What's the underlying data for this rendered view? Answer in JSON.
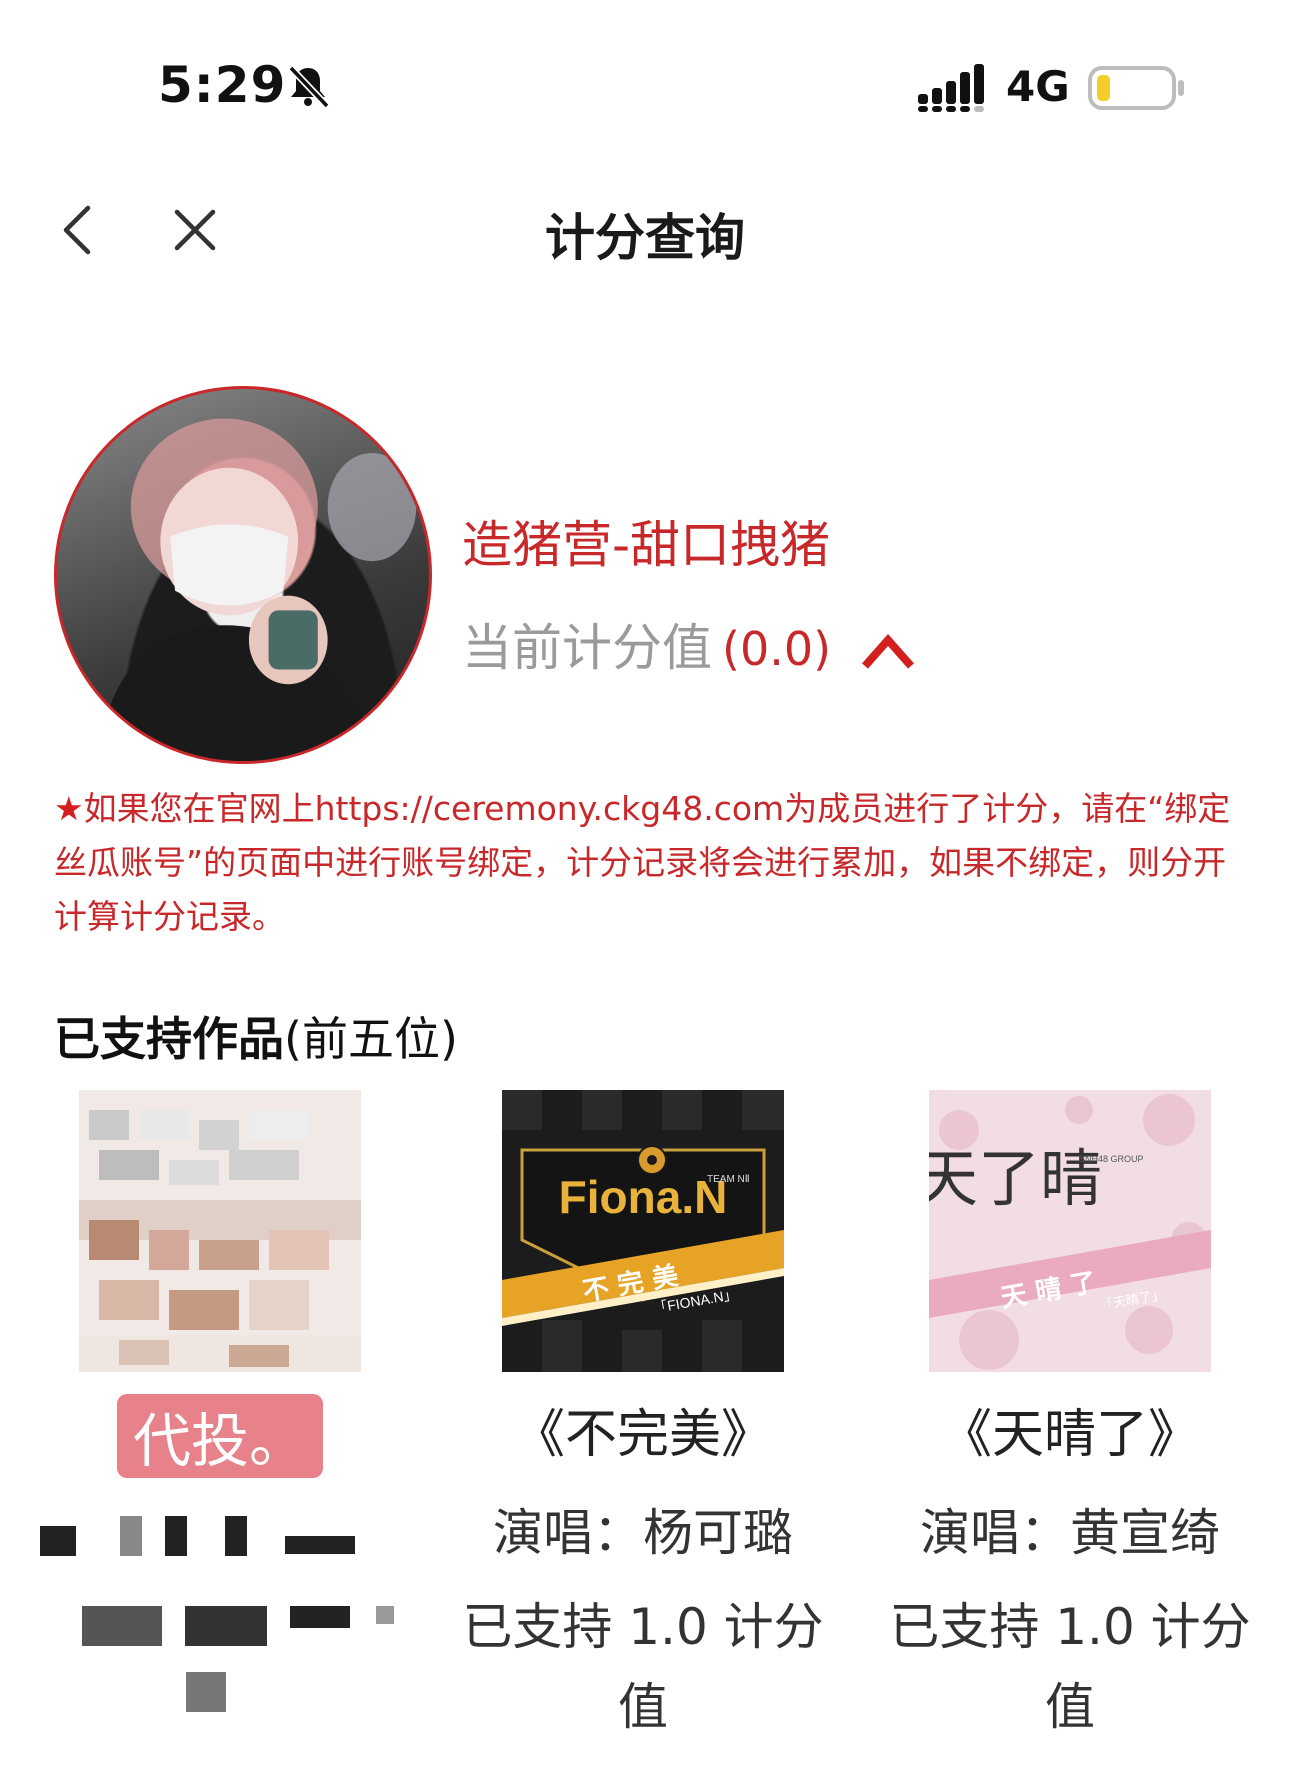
{
  "status_bar": {
    "time": "5:29",
    "network": "4G",
    "icons": [
      "bell-slash-icon",
      "signal-icon",
      "battery-icon"
    ],
    "battery_color": "#f5cc2a"
  },
  "nav": {
    "title": "计分查询",
    "back_icon": "chevron-left-icon",
    "close_icon": "close-icon"
  },
  "profile": {
    "username": "造猪营-甜口拽猪",
    "score_label": "当前计分值",
    "score_value": "(0.0)",
    "accent_color": "#c8282a"
  },
  "notice": {
    "star": "★",
    "text": "如果您在官网上https://ceremony.ckg48.com为成员进行了计分，请在“绑定丝瓜账号”的页面中进行账号绑定，计分记录将会进行累加，如果不绑定，则分开计算计分记录。"
  },
  "section": {
    "title_strong": "已支持作品",
    "title_rest": "(前五位)"
  },
  "works": [
    {
      "tag": "代投。",
      "cover_icon": "pixelated-cover"
    },
    {
      "title": "《不完美》",
      "singer": "演唱：杨可璐",
      "support": "已支持 1.0 计分值",
      "cover_text": "Fiona.N",
      "cover_sub": "不 完 美",
      "cover_tag": "「FIONA.N」",
      "cover_team": "TEAM NⅡ"
    },
    {
      "title": "《天晴了》",
      "singer": "演唱：黄宣绮",
      "support": "已支持 1.0 计分值",
      "cover_text": "天了晴",
      "cover_sub": "天 晴 了",
      "cover_tag": "「天晴了」",
      "cover_group": "SNH48 GROUP"
    }
  ]
}
